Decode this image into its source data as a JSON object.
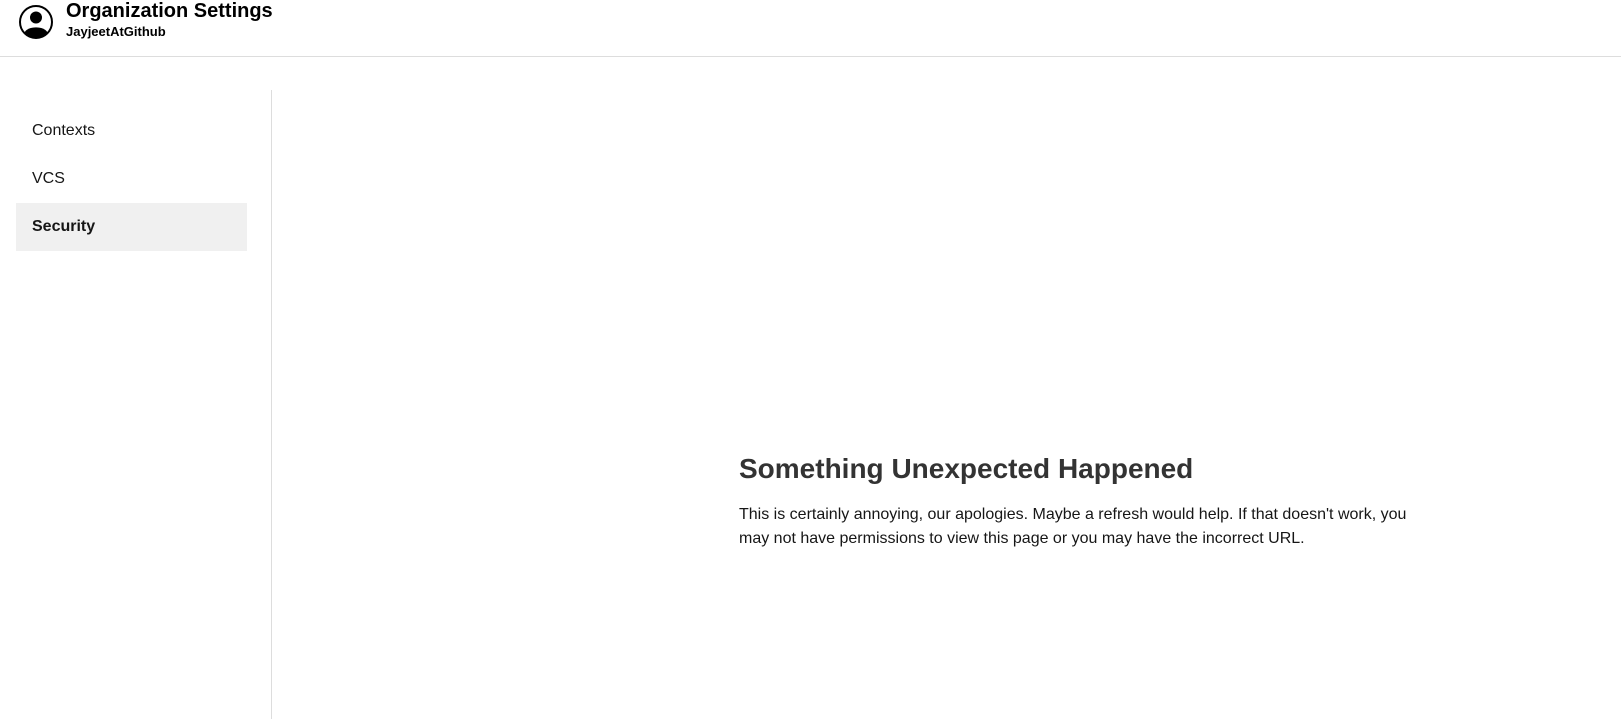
{
  "header": {
    "title": "Organization Settings",
    "org_name": "JayjeetAtGithub",
    "avatar_icon": "user-circle-icon"
  },
  "sidebar": {
    "items": [
      {
        "label": "Contexts",
        "active": false
      },
      {
        "label": "VCS",
        "active": false
      },
      {
        "label": "Security",
        "active": true
      }
    ]
  },
  "error": {
    "title": "Something Unexpected Happened",
    "message": "This is certainly annoying, our apologies. Maybe a refresh would help. If that doesn't work, you may not have permissions to view this page or you may have the incorrect URL."
  },
  "colors": {
    "active_item_bg": "#f0f0f0",
    "divider": "#dddddd",
    "heading": "#333333",
    "text": "#161616"
  }
}
